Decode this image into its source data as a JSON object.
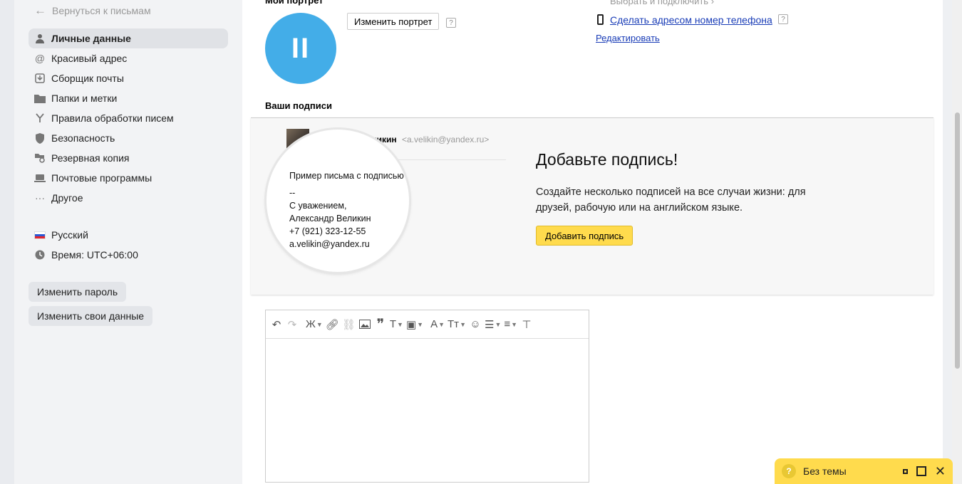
{
  "sidebar": {
    "back_label": "Вернуться к письмам",
    "items": [
      {
        "label": "Личные данные",
        "icon": "person-icon",
        "active": true
      },
      {
        "label": "Красивый адрес",
        "icon": "at-icon"
      },
      {
        "label": "Сборщик почты",
        "icon": "download-icon"
      },
      {
        "label": "Папки и метки",
        "icon": "folder-icon"
      },
      {
        "label": "Правила обработки писем",
        "icon": "filter-icon"
      },
      {
        "label": "Безопасность",
        "icon": "shield-icon"
      },
      {
        "label": "Резервная копия",
        "icon": "backup-icon"
      },
      {
        "label": "Почтовые программы",
        "icon": "laptop-icon"
      },
      {
        "label": "Другое",
        "icon": "dots-icon"
      }
    ],
    "language": "Русский",
    "time": "Время: UTC+06:00",
    "change_password": "Изменить пароль",
    "change_data": "Изменить свои данные"
  },
  "main": {
    "portrait_title": "Мой портрет",
    "avatar_initials": "II",
    "change_portrait": "Изменить портрет",
    "help": "?",
    "choose_connect": "Выбрать и подключить",
    "phone_link": "Сделать адресом номер телефона",
    "edit_link": "Редактировать",
    "signatures_title": "Ваши подписи"
  },
  "promo": {
    "sender_name": "Александр Великин",
    "sender_email": "<a.velikin@yandex.ru>",
    "sample_lines": [
      "Пример письма с подписью",
      "--",
      "С уважением,",
      "Александр Великин",
      "+7 (921) 323-12-55",
      "a.velikin@yandex.ru"
    ],
    "title": "Добавьте подпись!",
    "text": "Создайте несколько подписей на все случаи жизни: для друзей, рабочую или на английском языке.",
    "button": "Добавить подпись"
  },
  "editor": {
    "toolbar": {
      "bold_label": "Ж",
      "font_label": "A",
      "size_label": "Тт"
    }
  },
  "compose": {
    "title": "Без темы",
    "help": "?"
  },
  "colors": {
    "accent_yellow": "#ffdb4d",
    "avatar_blue": "#43ade8",
    "link_blue": "#1a3db7"
  }
}
